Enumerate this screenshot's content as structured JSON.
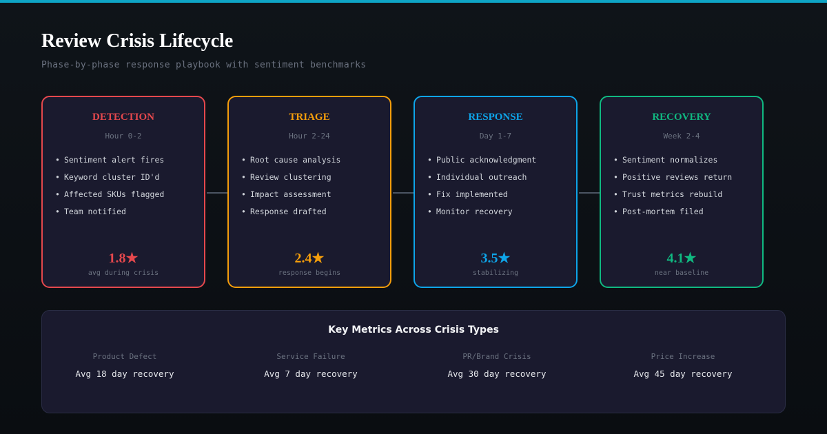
{
  "header": {
    "title": "Review Crisis Lifecycle",
    "subtitle": "Phase-by-phase response playbook with sentiment benchmarks"
  },
  "phases": [
    {
      "name": "DETECTION",
      "timeframe": "Hour 0-2",
      "color": "#e5484d",
      "items": [
        "Sentiment alert fires",
        "Keyword cluster ID'd",
        "Affected SKUs flagged",
        "Team notified"
      ],
      "rating": "1.8★",
      "rating_note": "avg during crisis"
    },
    {
      "name": "TRIAGE",
      "timeframe": "Hour 2-24",
      "color": "#f59e0b",
      "items": [
        "Root cause analysis",
        "Review clustering",
        "Impact assessment",
        "Response drafted"
      ],
      "rating": "2.4★",
      "rating_note": "response begins"
    },
    {
      "name": "RESPONSE",
      "timeframe": "Day 1-7",
      "color": "#0ea5e9",
      "items": [
        "Public acknowledgment",
        "Individual outreach",
        "Fix implemented",
        "Monitor recovery"
      ],
      "rating": "3.5★",
      "rating_note": "stabilizing"
    },
    {
      "name": "RECOVERY",
      "timeframe": "Week 2-4",
      "color": "#10b981",
      "items": [
        "Sentiment normalizes",
        "Positive reviews return",
        "Trust metrics rebuild",
        "Post-mortem filed"
      ],
      "rating": "4.1★",
      "rating_note": "near baseline"
    }
  ],
  "metrics": {
    "title": "Key Metrics Across Crisis Types",
    "items": [
      {
        "label": "Product Defect",
        "value": "Avg 18 day recovery"
      },
      {
        "label": "Service Failure",
        "value": "Avg 7 day recovery"
      },
      {
        "label": "PR/Brand Crisis",
        "value": "Avg 30 day recovery"
      },
      {
        "label": "Price Increase",
        "value": "Avg 45 day recovery"
      }
    ]
  }
}
